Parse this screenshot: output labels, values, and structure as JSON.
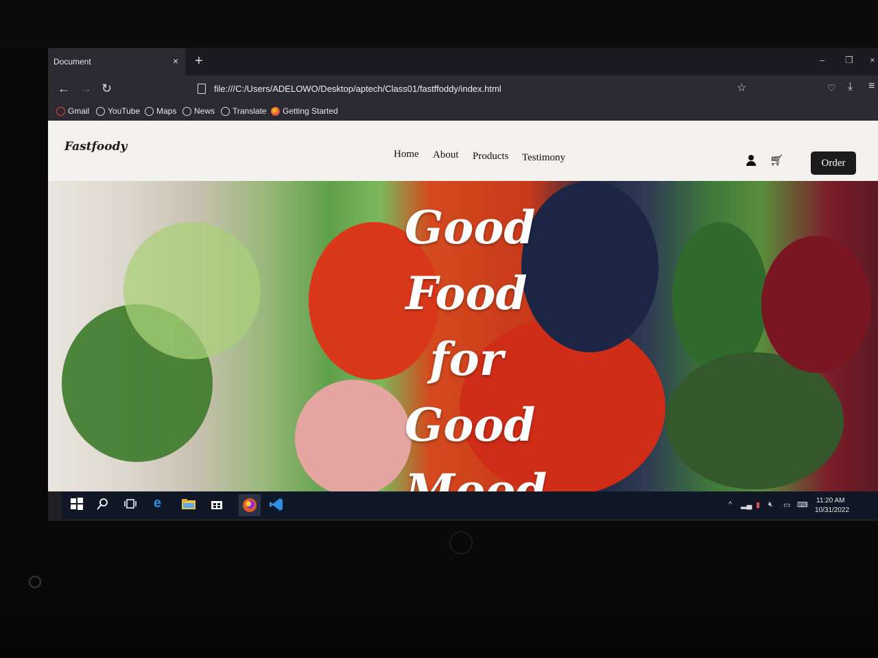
{
  "browser": {
    "tab_title": "Document",
    "tab_close": "×",
    "new_tab": "+",
    "url": "file:///C:/Users/ADELOWO/Desktop/aptech/Class01/fastffoddy/index.html",
    "back": "←",
    "forward": "→",
    "reload": "↻",
    "window_controls": {
      "minimize": "–",
      "restore": "❐",
      "close": "×"
    }
  },
  "bookmarks": [
    {
      "label": "Gmail",
      "icon": "google-icon"
    },
    {
      "label": "YouTube",
      "icon": "globe-icon"
    },
    {
      "label": "Maps",
      "icon": "globe-icon"
    },
    {
      "label": "News",
      "icon": "globe-icon"
    },
    {
      "label": "Translate",
      "icon": "globe-icon"
    },
    {
      "label": "Getting Started",
      "icon": "firefox-icon"
    }
  ],
  "site": {
    "logo": "Fastfoody",
    "nav": [
      "Home",
      "About",
      "Products",
      "Testimony"
    ],
    "order_button": "Order",
    "hero_lines": [
      "Good",
      "Food",
      "for",
      "Good",
      "Mood"
    ]
  },
  "taskbar": {
    "time": "11:20 AM",
    "date": "10/31/2022"
  },
  "colors": {
    "page_background": "#f3f1ee",
    "order_button": "#1b1b1b",
    "browser_chrome": "#2b2a33",
    "taskbar": "#101827"
  }
}
